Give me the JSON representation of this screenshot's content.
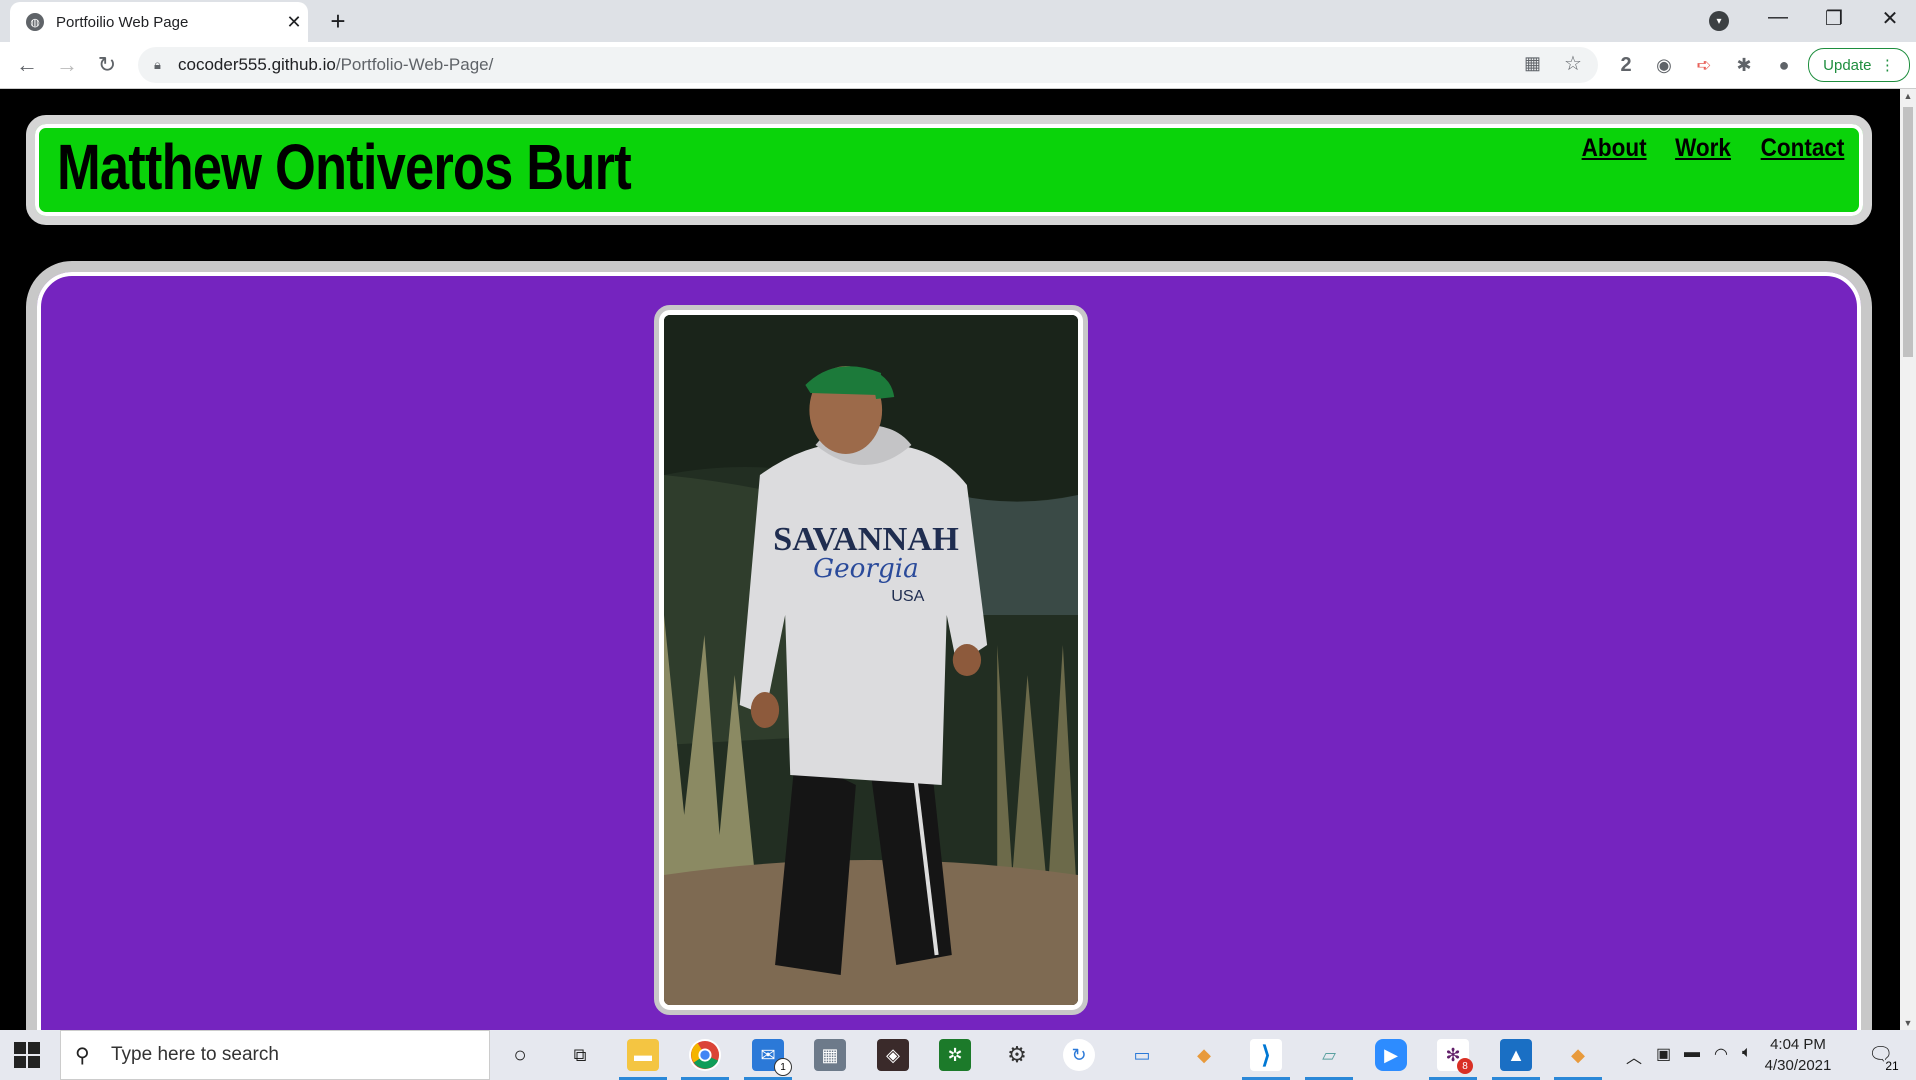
{
  "browser": {
    "tab_title": "Portfoilio Web Page",
    "url_host": "cocoder555.github.io",
    "url_path": "/Portfolio-Web-Page/",
    "update_label": "Update",
    "profile_badge": "2"
  },
  "page": {
    "name": "Matthew Ontiveros Burt",
    "nav": [
      {
        "label": "About"
      },
      {
        "label": "Work"
      },
      {
        "label": "Contact"
      }
    ],
    "photo_alt": "Portrait photo of a man in a green cap and white SAVANNAH Georgia USA hoodie standing outdoors",
    "colors": {
      "header_bg": "#0ad30a",
      "main_bg": "#7524bf",
      "page_bg": "#000000"
    }
  },
  "taskbar": {
    "search_placeholder": "Type here to search",
    "time": "4:04 PM",
    "date": "4/30/2021",
    "mail_badge": "1",
    "slack_badge": "8",
    "notif_count": "21"
  }
}
